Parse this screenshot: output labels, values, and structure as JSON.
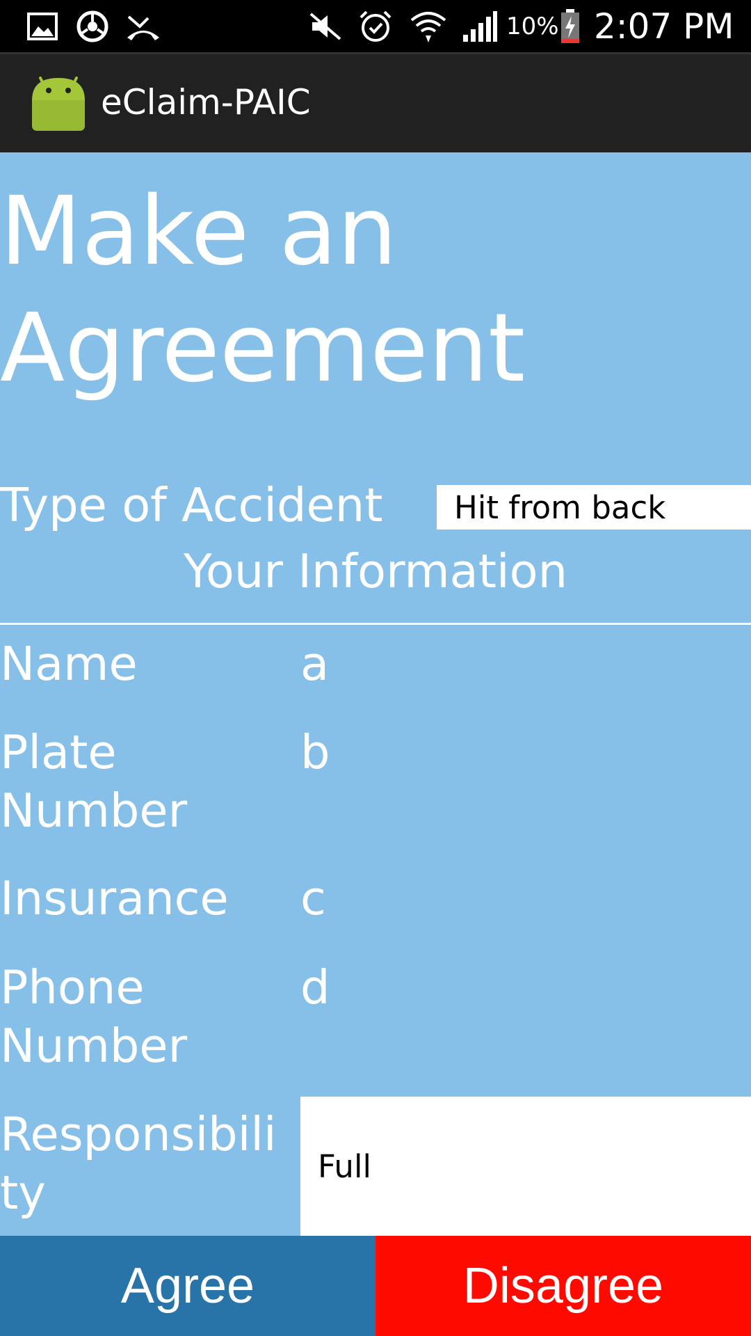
{
  "status_bar": {
    "battery_percent": "10%",
    "time": "2:07 PM",
    "icons": [
      "gallery-icon",
      "chrome-icon",
      "missed-call-icon",
      "mute-icon",
      "alarm-icon",
      "wifi-icon",
      "signal-icon",
      "battery-charging-icon"
    ]
  },
  "app_bar": {
    "title": "eClaim-PAIC",
    "icon": "android-icon"
  },
  "main": {
    "page_title": "Make an Agreement",
    "accident_label": "Type of Accident",
    "accident_value": "Hit from back",
    "section_heading": "Your Information",
    "fields": {
      "name_label": "Name",
      "name_value": "a",
      "plate_label": "Plate Number",
      "plate_value": "b",
      "insurance_label": "Insurance",
      "insurance_value": "c",
      "phone_label": "Phone Number",
      "phone_value": "d",
      "responsibility_label": "Responsibility",
      "responsibility_value": "Full"
    }
  },
  "buttons": {
    "agree_label": "Agree",
    "disagree_label": "Disagree"
  },
  "colors": {
    "content_bg": "#86c0e8",
    "agree_bg": "#2874a8",
    "disagree_bg": "#ff0a00",
    "action_bar_bg": "#212121"
  }
}
